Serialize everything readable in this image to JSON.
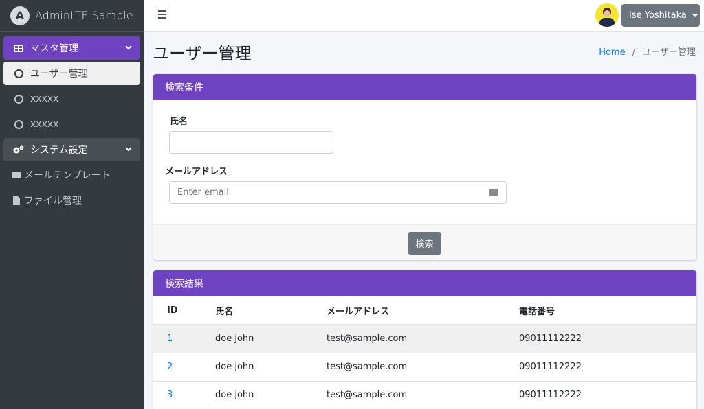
{
  "brand": {
    "logo_letter": "A",
    "title": "AdminLTE Sample"
  },
  "sidebar": {
    "items": [
      {
        "label": "マスタ管理",
        "icon": "grid-icon",
        "state": "active-parent"
      },
      {
        "label": "ユーザー管理",
        "icon": "circle-icon",
        "state": "active-child"
      },
      {
        "label": "xxxxx",
        "icon": "circle-icon"
      },
      {
        "label": "xxxxx",
        "icon": "circle-icon"
      },
      {
        "label": "システム設定",
        "icon": "gears-icon",
        "state": "open-parent"
      },
      {
        "label": "メールテンプレート",
        "icon": "envelope-icon"
      },
      {
        "label": "ファイル管理",
        "icon": "file-icon"
      }
    ]
  },
  "topbar": {
    "user_name": "Ise Yoshitaka"
  },
  "page": {
    "title": "ユーザー管理"
  },
  "breadcrumb": {
    "home": "Home",
    "sep": "/",
    "current": "ユーザー管理"
  },
  "search": {
    "header": "検索条件",
    "name_label": "氏名",
    "name_value": "",
    "email_label": "メールアドレス",
    "email_placeholder": "Enter email",
    "button": "検索"
  },
  "results": {
    "header": "検索結果",
    "columns": [
      "ID",
      "氏名",
      "メールアドレス",
      "電話番号"
    ],
    "rows": [
      {
        "id": "1",
        "name": "doe john",
        "email": "test@sample.com",
        "phone": "09011112222"
      },
      {
        "id": "2",
        "name": "doe john",
        "email": "test@sample.com",
        "phone": "09011112222"
      },
      {
        "id": "3",
        "name": "doe john",
        "email": "test@sample.com",
        "phone": "09011112222"
      }
    ]
  },
  "colors": {
    "accent": "#6f42c1",
    "sidebar_bg": "#343a40",
    "link": "#007bff",
    "button_gray": "#6c757d"
  }
}
